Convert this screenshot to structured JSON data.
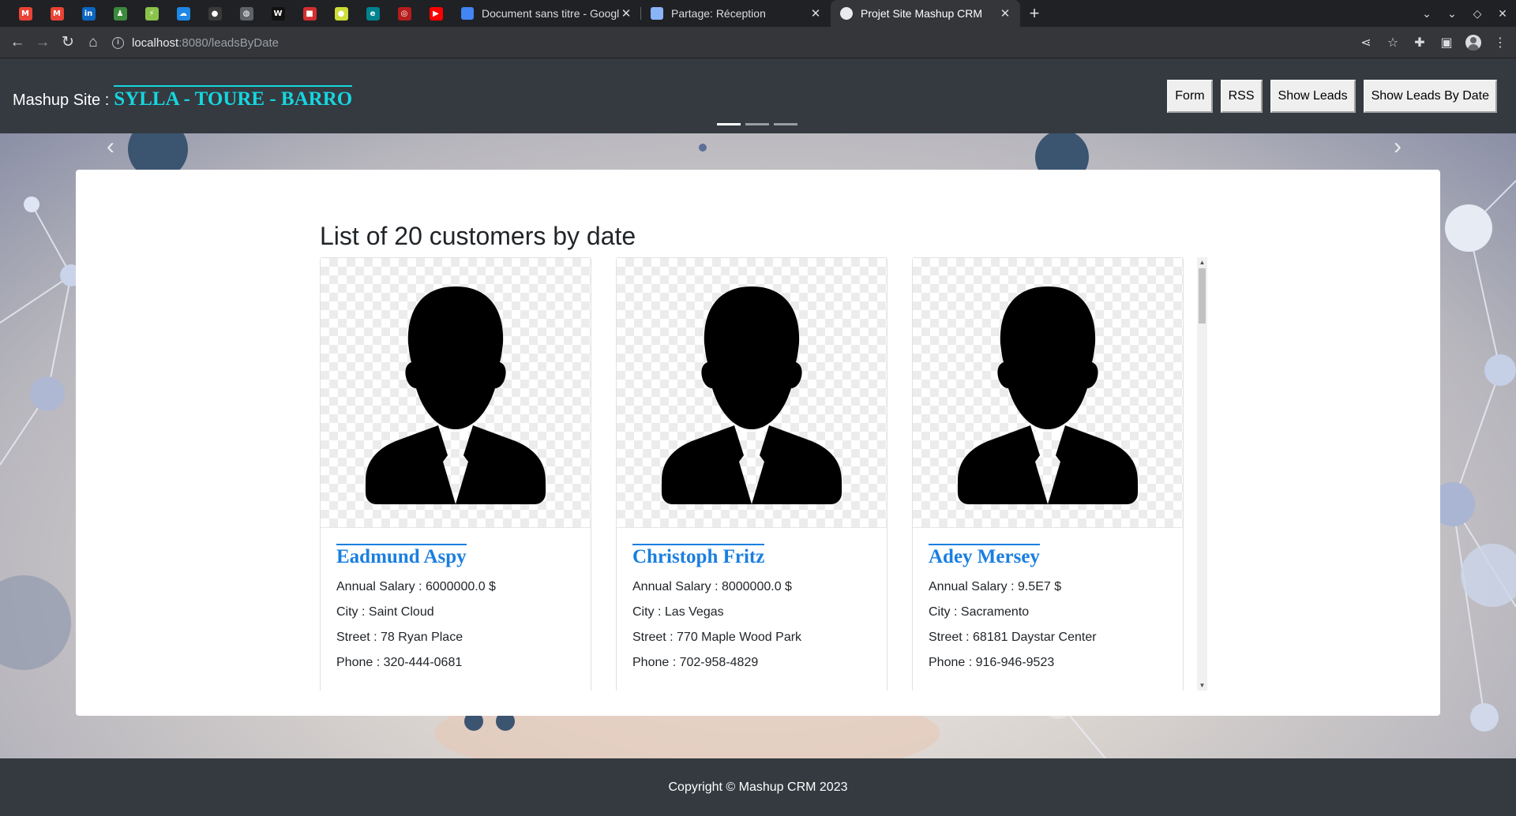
{
  "browser": {
    "pinned_tabs": [
      {
        "icon": "gmail-icon",
        "color": "#ea4335",
        "glyph": "M"
      },
      {
        "icon": "gmail-icon",
        "color": "#ea4335",
        "glyph": "M"
      },
      {
        "icon": "linkedin-icon",
        "color": "#0a66c2",
        "glyph": "in"
      },
      {
        "icon": "app-icon",
        "color": "#3c8b3c",
        "glyph": "♟"
      },
      {
        "icon": "app-icon",
        "color": "#8bc34a",
        "glyph": "⚡"
      },
      {
        "icon": "cloud-icon",
        "color": "#1e88e5",
        "glyph": "☁"
      },
      {
        "icon": "github-icon",
        "color": "#3a3a3a",
        "glyph": "●"
      },
      {
        "icon": "globe-icon",
        "color": "#5f6368",
        "glyph": "◍"
      },
      {
        "icon": "app-icon",
        "color": "#111111",
        "glyph": "W"
      },
      {
        "icon": "app-icon",
        "color": "#d32f2f",
        "glyph": "■"
      },
      {
        "icon": "app-icon",
        "color": "#cddc39",
        "glyph": "●"
      },
      {
        "icon": "app-icon",
        "color": "#00838f",
        "glyph": "e"
      },
      {
        "icon": "app-icon",
        "color": "#b71c1c",
        "glyph": "◎"
      },
      {
        "icon": "youtube-icon",
        "color": "#ff0000",
        "glyph": "▶"
      }
    ],
    "tabs": [
      {
        "title": "Document sans titre - Google",
        "favicon_color": "#4285f4"
      },
      {
        "title": "Partage: Réception",
        "favicon_color": "#8ab4f8"
      },
      {
        "title": "Projet Site Mashup CRM",
        "favicon_color": "#e8eaed"
      }
    ],
    "url_host": "localhost",
    "url_path": ":8080/leadsByDate"
  },
  "header": {
    "brand_label": "Mashup Site :",
    "brand_names": "SYLLA - TOURE - BARRO",
    "nav": [
      "Form",
      "RSS",
      "Show Leads",
      "Show Leads By Date"
    ]
  },
  "main": {
    "title": "List of 20 customers by date",
    "customers": [
      {
        "name": "Eadmund Aspy",
        "salary": "Annual Salary : 6000000.0 $",
        "city": "City : Saint Cloud",
        "street": "Street : 78 Ryan Place",
        "phone": "Phone : 320-444-0681"
      },
      {
        "name": "Christoph Fritz",
        "salary": "Annual Salary : 8000000.0 $",
        "city": "City : Las Vegas",
        "street": "Street : 770 Maple Wood Park",
        "phone": "Phone : 702-958-4829"
      },
      {
        "name": "Adey Mersey",
        "salary": "Annual Salary : 9.5E7 $",
        "city": "City : Sacramento",
        "street": "Street : 68181 Daystar Center",
        "phone": "Phone : 916-946-9523"
      }
    ]
  },
  "footer": {
    "copyright": "Copyright © Mashup CRM 2023"
  }
}
